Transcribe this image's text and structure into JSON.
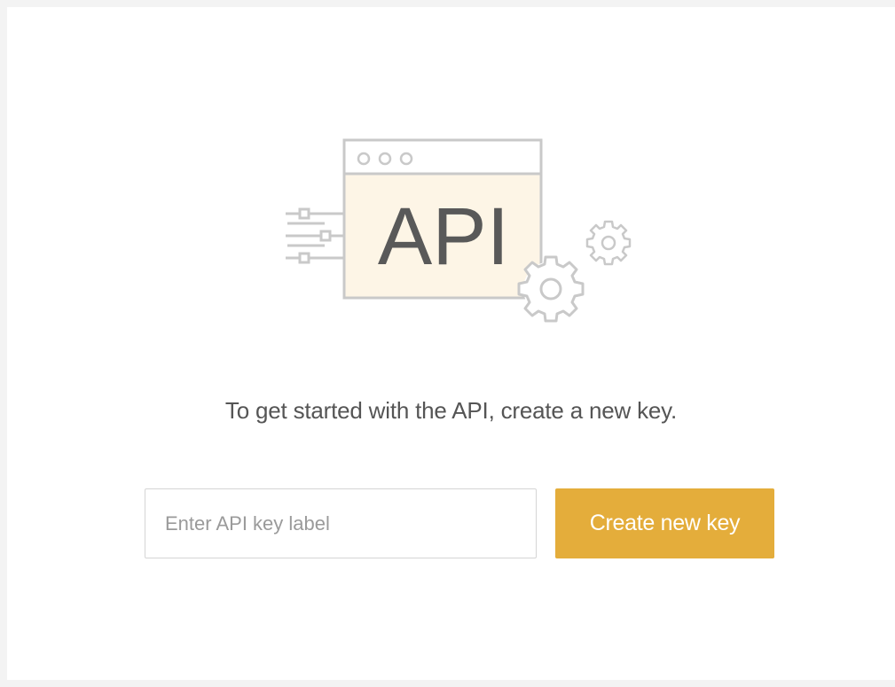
{
  "illustration": {
    "label": "API",
    "icons": [
      "browser-window-icon",
      "connector-lines-icon",
      "large-gear-icon",
      "small-gear-icon"
    ]
  },
  "main": {
    "message": "To get started with the API, create a new key."
  },
  "form": {
    "input_value": "",
    "input_placeholder": "Enter API key label",
    "create_button_label": "Create new key"
  },
  "colors": {
    "background": "#f3f3f3",
    "panel": "#ffffff",
    "accent": "#e4ad3b",
    "illustration_fill": "#fdf5e6",
    "illustration_stroke": "#c9c9c9",
    "text": "#555555"
  }
}
